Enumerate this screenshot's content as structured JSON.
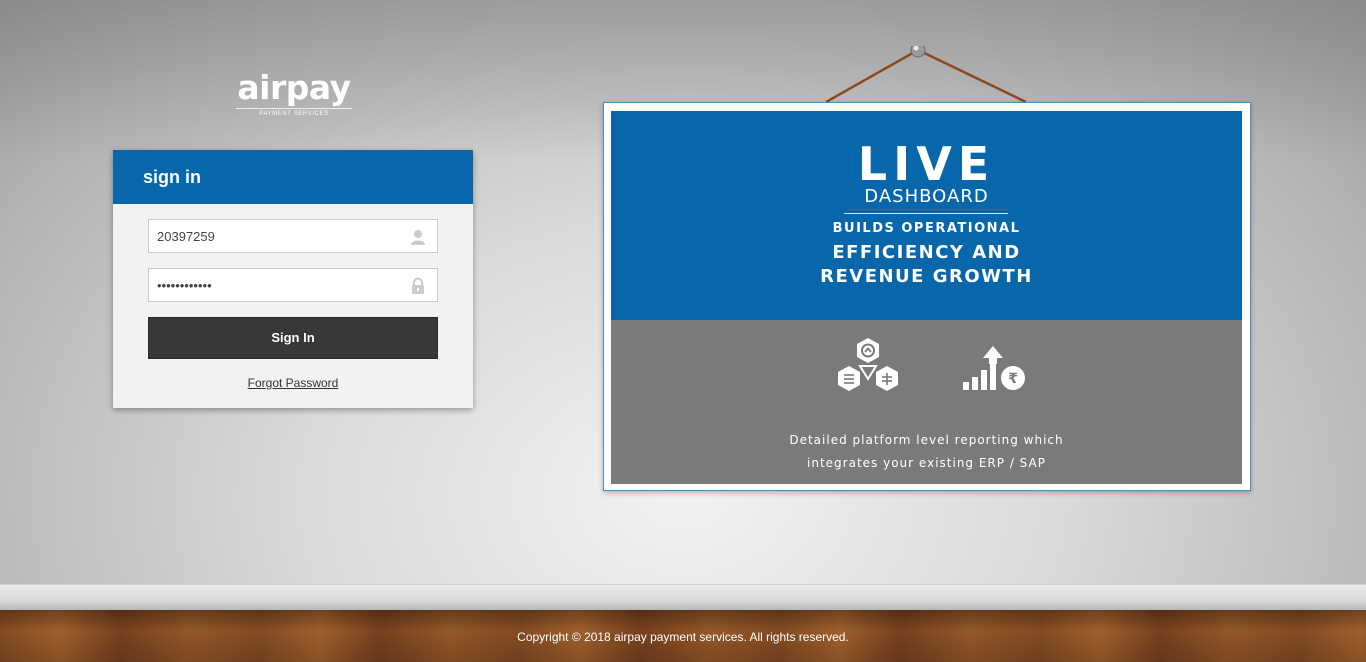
{
  "brand": {
    "name": "airpay",
    "tagline": "PAYMENT SERVICES"
  },
  "signin": {
    "title": "sign in",
    "username_value": "20397259",
    "password_value": "••••••••••••",
    "button_label": "Sign In",
    "forgot_label": "Forgot Password"
  },
  "board": {
    "headline": "LIVE",
    "subhead": "DASHBOARD",
    "line1": "BUILDS OPERATIONAL",
    "line2": "EFFICIENCY AND",
    "line3": "REVENUE GROWTH",
    "desc1": "Detailed platform level reporting which",
    "desc2": "integrates your existing ERP / SAP",
    "icons": [
      "modules-hexagon-icon",
      "revenue-growth-icon"
    ]
  },
  "footer": {
    "copyright": "Copyright © 2018 airpay payment services. All rights reserved."
  },
  "colors": {
    "primary_blue": "#0866aa",
    "button_dark": "#383838",
    "board_gray": "#7a7a7a"
  }
}
